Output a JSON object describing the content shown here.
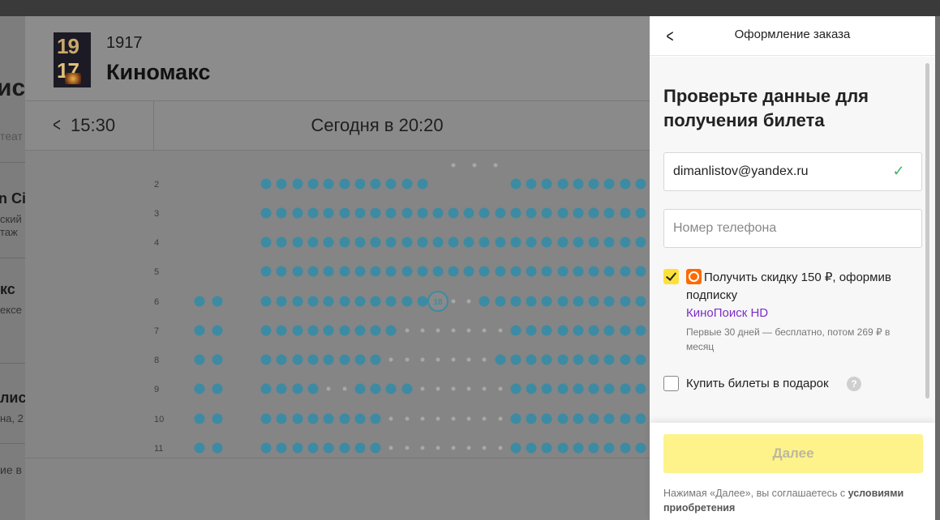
{
  "background": {
    "fragments": [
      "ис",
      "теат",
      "n Ci",
      "ский",
      "таж",
      "кс",
      "ексе",
      "лис",
      "на, 2",
      "ие в"
    ]
  },
  "movie": {
    "poster_lines": [
      "19",
      "17"
    ],
    "title": "1917",
    "cinema": "Киномакс"
  },
  "time_bar": {
    "back_time": "15:30",
    "session": "Сегодня в 20:20"
  },
  "seatmap": {
    "rows": [
      "2",
      "3",
      "4",
      "5",
      "6",
      "7",
      "8",
      "9",
      "10",
      "11"
    ],
    "selected_seat": {
      "row": "6",
      "label": "18"
    },
    "colors": {
      "free": "#3d8ba3",
      "taken": "#a7a7a7",
      "selected_ring": "#3d8ba3"
    }
  },
  "order": {
    "back_icon": "chevron-left-icon",
    "title": "Оформление заказа",
    "heading": "Проверьте данные для получения билета",
    "email": {
      "value": "dimanlistov@yandex.ru",
      "valid_icon": "check-icon"
    },
    "phone": {
      "placeholder": "Номер телефона",
      "value": ""
    },
    "subscription": {
      "checked": true,
      "text": "Получить скидку 150 ₽, оформив подписку",
      "link": "КиноПоиск HD",
      "note": "Первые 30 дней — бесплатно, потом 269 ₽ в месяц",
      "icon": "kinopoisk-icon"
    },
    "gift": {
      "checked": false,
      "label": "Купить билеты в подарок",
      "help": "?"
    },
    "next_button": "Далее",
    "legal_prefix": "Нажимая «Далее», вы соглашаетесь с ",
    "legal_link": "условиями приобретения",
    "accent_color": "#fde13b"
  }
}
